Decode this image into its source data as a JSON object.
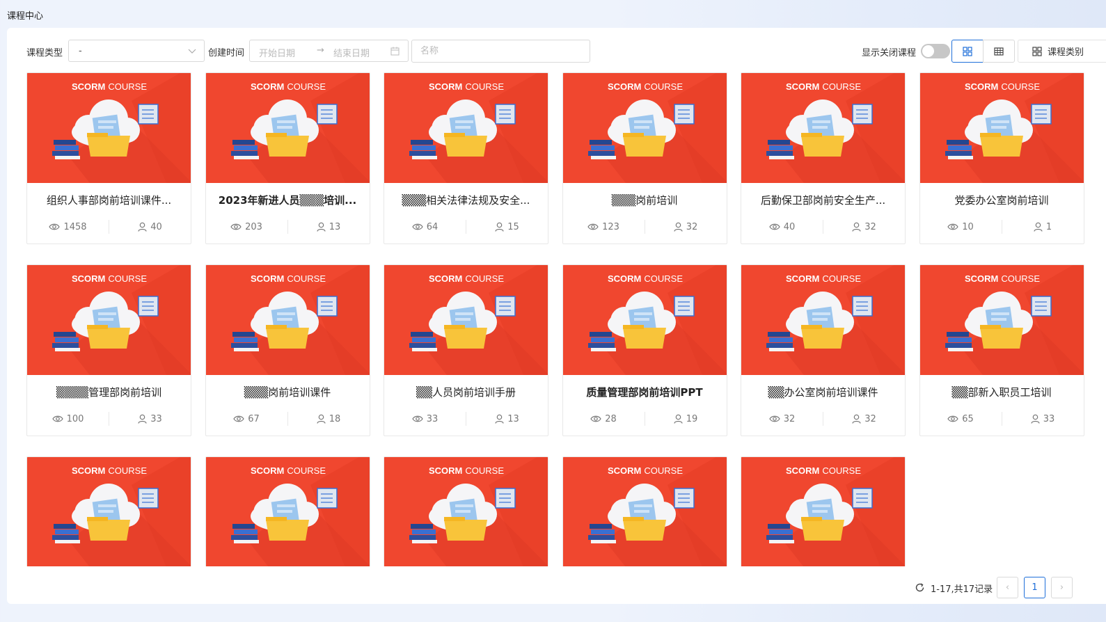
{
  "header": {
    "title": "课程中心"
  },
  "filters": {
    "type_label": "课程类型",
    "type_value": "-",
    "created_label": "创建时间",
    "start_placeholder": "开始日期",
    "end_placeholder": "结束日期",
    "name_placeholder": "名称",
    "show_closed_label": "显示关闭课程",
    "category_button": "课程类别"
  },
  "thumbnail": {
    "brand_bold": "SCORM",
    "brand_light": "COURSE",
    "bg_color": "#f0472f"
  },
  "courses": [
    {
      "title": "组织人事部岗前培训课件...",
      "views": "1458",
      "users": "40"
    },
    {
      "title": "2023年新进人员▒▒▒培训...",
      "views": "203",
      "users": "13"
    },
    {
      "title": "▒▒▒相关法律法规及安全...",
      "views": "64",
      "users": "15"
    },
    {
      "title": "▒▒▒岗前培训",
      "views": "123",
      "users": "32"
    },
    {
      "title": "后勤保卫部岗前安全生产...",
      "views": "40",
      "users": "32"
    },
    {
      "title": "党委办公室岗前培训",
      "views": "10",
      "users": "1"
    },
    {
      "title": "▒▒▒▒管理部岗前培训",
      "views": "100",
      "users": "33"
    },
    {
      "title": "▒▒▒岗前培训课件",
      "views": "67",
      "users": "18"
    },
    {
      "title": "▒▒人员岗前培训手册",
      "views": "33",
      "users": "13"
    },
    {
      "title": "质量管理部岗前培训PPT",
      "views": "28",
      "users": "19"
    },
    {
      "title": "▒▒办公室岗前培训课件",
      "views": "32",
      "users": "32"
    },
    {
      "title": "▒▒部新入职员工培训",
      "views": "65",
      "users": "33"
    },
    {
      "title": "",
      "views": "",
      "users": ""
    },
    {
      "title": "",
      "views": "",
      "users": ""
    },
    {
      "title": "",
      "views": "",
      "users": ""
    },
    {
      "title": "",
      "views": "",
      "users": ""
    },
    {
      "title": "",
      "views": "",
      "users": ""
    }
  ],
  "pagination": {
    "total_text": "1-17,共17记录",
    "current_page": "1",
    "prev": "‹",
    "next": "›"
  }
}
